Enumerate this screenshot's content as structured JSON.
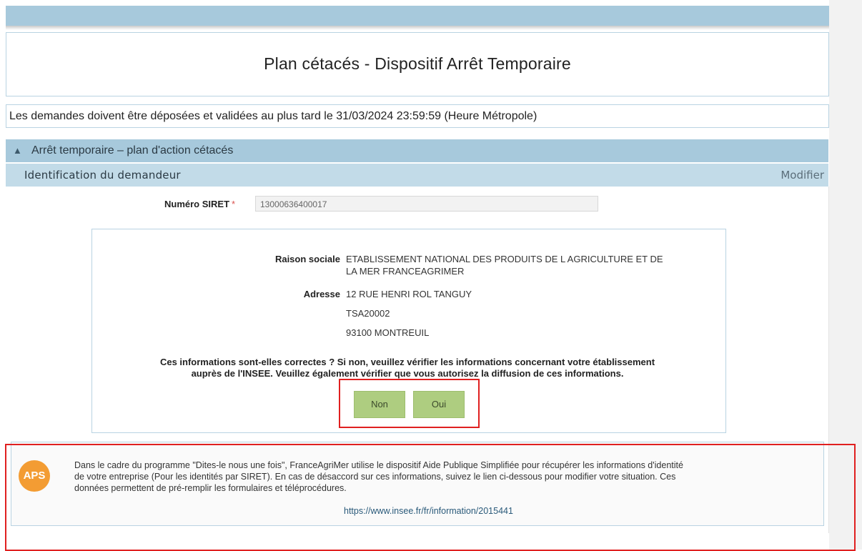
{
  "page": {
    "title": "Plan cétacés - Dispositif Arrêt Temporaire"
  },
  "deadline": {
    "text": "Les demandes doivent être déposées et validées au plus tard le 31/03/2024 23:59:59 (Heure Métropole)"
  },
  "section": {
    "chevron_icon": "chevron-up-icon",
    "label": "Arrêt temporaire – plan d'action cétacés"
  },
  "identification": {
    "label": "Identification du demandeur",
    "modify_label": "Modifier"
  },
  "siret": {
    "label": "Numéro SIRET",
    "required_mark": "*",
    "value": "13000636400017"
  },
  "company": {
    "raison_sociale_label": "Raison sociale",
    "raison_sociale_line1": "ETABLISSEMENT NATIONAL DES PRODUITS DE L AGRICULTURE ET DE",
    "raison_sociale_line2": "LA MER FRANCEAGRIMER",
    "adresse_label": "Adresse",
    "adresse_line1": "12 RUE HENRI ROL TANGUY",
    "adresse_line2": "TSA20002",
    "adresse_line3": "93100 MONTREUIL"
  },
  "question": {
    "line1": "Ces informations sont-elles correctes ? Si non, veuillez vérifier les informations concernant votre établissement",
    "line2": "auprès de l'INSEE. Veuillez également vérifier que vous autorisez la diffusion de ces informations."
  },
  "buttons": {
    "non": "Non",
    "oui": "Oui"
  },
  "aps": {
    "badge": "APS",
    "line1": "Dans le cadre du programme \"Dites-le nous une fois\", FranceAgriMer utilise le dispositif Aide Publique Simplifiée pour récupérer les informations d'identité",
    "line2": "de votre entreprise (Pour les identités par SIRET). En cas de désaccord sur ces informations, suivez le lien ci-dessous pour modifier votre situation. Ces",
    "line3": "données permettent de pré-remplir les formulaires et téléprocédures.",
    "link": "https://www.insee.fr/fr/information/2015441"
  },
  "colors": {
    "header_blue": "#a7c9dc",
    "subheader_blue": "#c2dbe8",
    "button_green": "#aecd80",
    "badge_orange": "#f39c33",
    "highlight_red": "#e02020"
  }
}
